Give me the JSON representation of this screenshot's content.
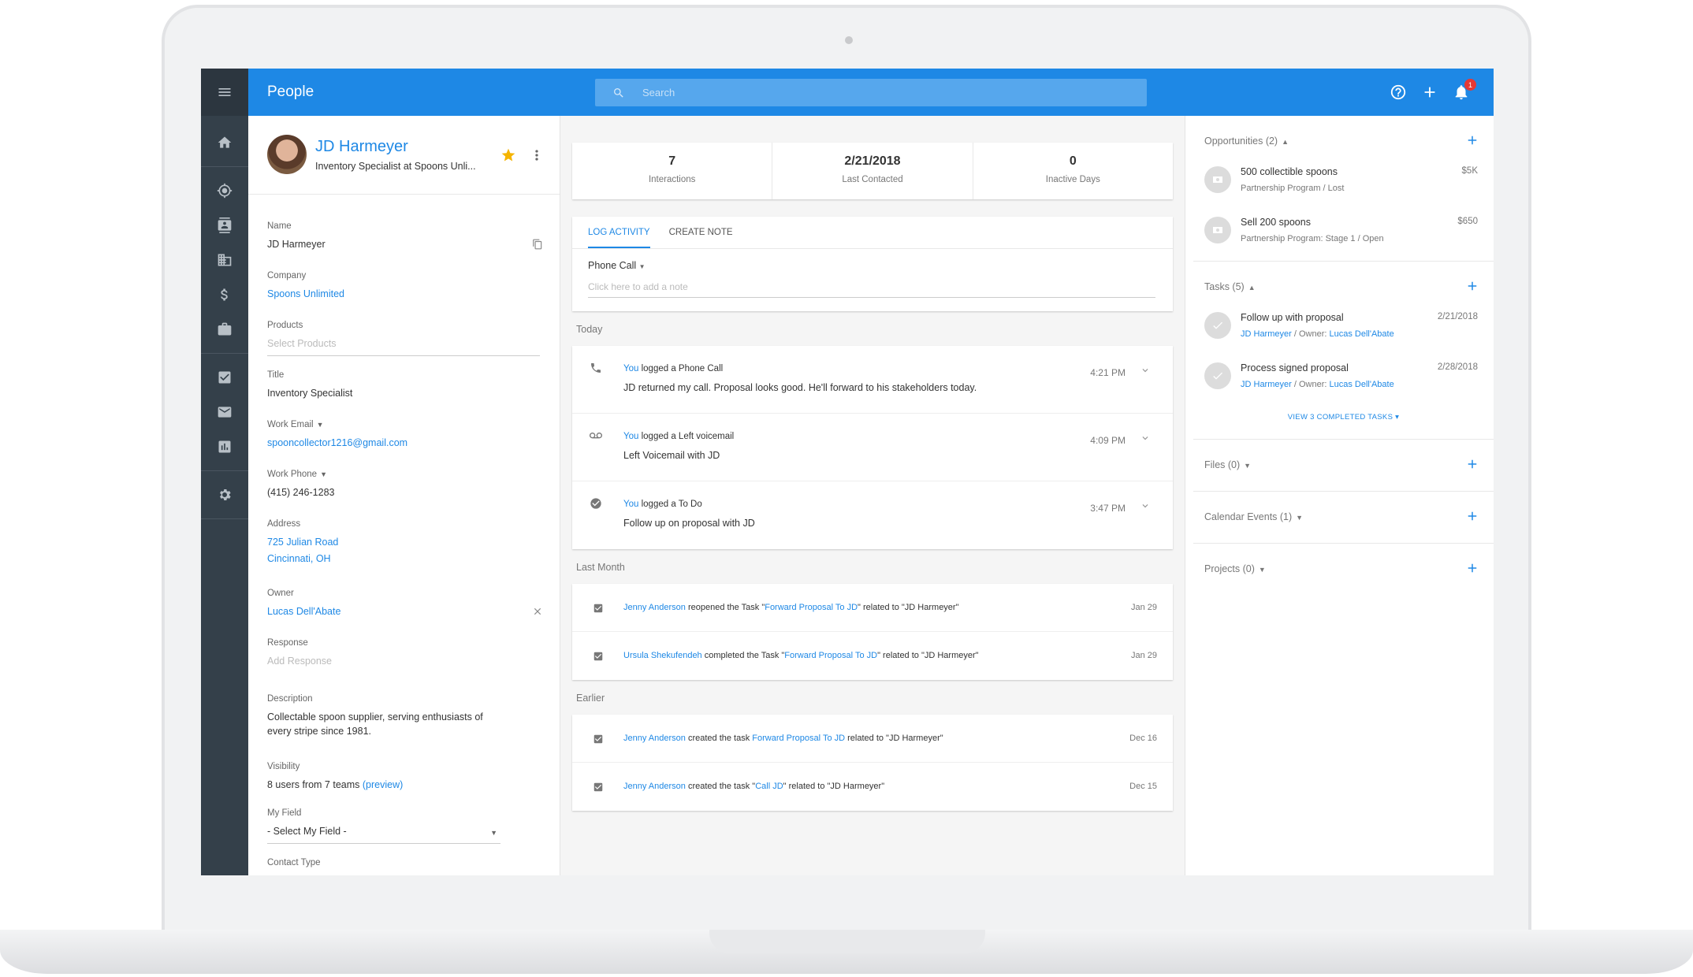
{
  "app": {
    "title": "People",
    "search_placeholder": "Search",
    "notification_count": "1"
  },
  "profile": {
    "name": "JD Harmeyer",
    "subtitle": "Inventory Specialist at Spoons Unli...",
    "fields": {
      "name_label": "Name",
      "name_value": "JD Harmeyer",
      "company_label": "Company",
      "company_value": "Spoons Unlimited",
      "products_label": "Products",
      "products_placeholder": "Select Products",
      "title_label": "Title",
      "title_value": "Inventory Specialist",
      "email_label": "Work Email",
      "email_value": "spooncollector1216@gmail.com",
      "phone_label": "Work Phone",
      "phone_value": "(415) 246-1283",
      "address_label": "Address",
      "address_line1": "725 Julian Road",
      "address_line2": "Cincinnati, OH",
      "owner_label": "Owner",
      "owner_value": "Lucas Dell'Abate",
      "response_label": "Response",
      "response_placeholder": "Add Response",
      "description_label": "Description",
      "description_line1": "Collectable spoon supplier, serving enthusiasts of",
      "description_line2": "every stripe since 1981.",
      "visibility_label": "Visibility",
      "visibility_value": "8 users from 7 teams",
      "visibility_link": "(preview)",
      "myfield_label": "My Field",
      "myfield_value": "- Select My Field -",
      "contacttype_label": "Contact Type"
    }
  },
  "stats": [
    {
      "value": "7",
      "label": "Interactions"
    },
    {
      "value": "2/21/2018",
      "label": "Last Contacted"
    },
    {
      "value": "0",
      "label": "Inactive Days"
    }
  ],
  "log_activity": {
    "tabs": [
      "LOG ACTIVITY",
      "CREATE NOTE"
    ],
    "activity_type": "Phone Call",
    "note_placeholder": "Click here to add a note"
  },
  "feed": {
    "today_label": "Today",
    "today": [
      {
        "actor": "You",
        "action": " logged a Phone Call",
        "text": "JD returned my call. Proposal looks good. He'll forward to his stakeholders today.",
        "time": "4:21 PM",
        "icon": "phone-icon"
      },
      {
        "actor": "You",
        "action": " logged a Left voicemail",
        "text": "Left Voicemail with JD",
        "time": "4:09 PM",
        "icon": "voicemail-icon"
      },
      {
        "actor": "You",
        "action": " logged a To Do",
        "text": "Follow up on proposal with JD",
        "time": "3:47 PM",
        "icon": "check-circle-icon"
      }
    ],
    "last_month_label": "Last Month",
    "last_month": [
      {
        "actor": "Jenny Anderson",
        "pre": " reopened the Task \"",
        "task": "Forward Proposal To JD",
        "post": "\" related to \"JD Harmeyer\"",
        "date": "Jan 29"
      },
      {
        "actor": "Ursula Shekufendeh",
        "pre": " completed the Task \"",
        "task": "Forward Proposal To JD",
        "post": "\" related to \"JD Harmeyer\"",
        "date": "Jan 29"
      }
    ],
    "earlier_label": "Earlier",
    "earlier": [
      {
        "actor": "Jenny Anderson",
        "pre": " created the task ",
        "task": "Forward Proposal To JD",
        "post": " related to \"JD Harmeyer\"",
        "date": "Dec 16"
      },
      {
        "actor": "Jenny Anderson",
        "pre": " created the task \"",
        "task": "Call JD",
        "post": "\" related to \"JD Harmeyer\"",
        "date": "Dec 15"
      }
    ]
  },
  "right": {
    "opportunities_label": "Opportunities (2)",
    "opportunities": [
      {
        "title": "500 collectible spoons",
        "sub": "Partnership Program / Lost",
        "value": "$5K"
      },
      {
        "title": "Sell 200 spoons",
        "sub": "Partnership Program: Stage 1 / Open",
        "value": "$650"
      }
    ],
    "tasks_label": "Tasks (5)",
    "tasks": [
      {
        "title": "Follow up with proposal",
        "person": "JD Harmeyer",
        "owner_prefix": " / Owner: ",
        "owner": "Lucas Dell'Abate",
        "date": "2/21/2018"
      },
      {
        "title": "Process signed proposal",
        "person": "JD Harmeyer",
        "owner_prefix": " / Owner: ",
        "owner": "Lucas Dell'Abate",
        "date": "2/28/2018"
      }
    ],
    "view_completed": "VIEW 3 COMPLETED TASKS",
    "files_label": "Files (0)",
    "calendar_label": "Calendar Events (1)",
    "projects_label": "Projects (0)"
  }
}
